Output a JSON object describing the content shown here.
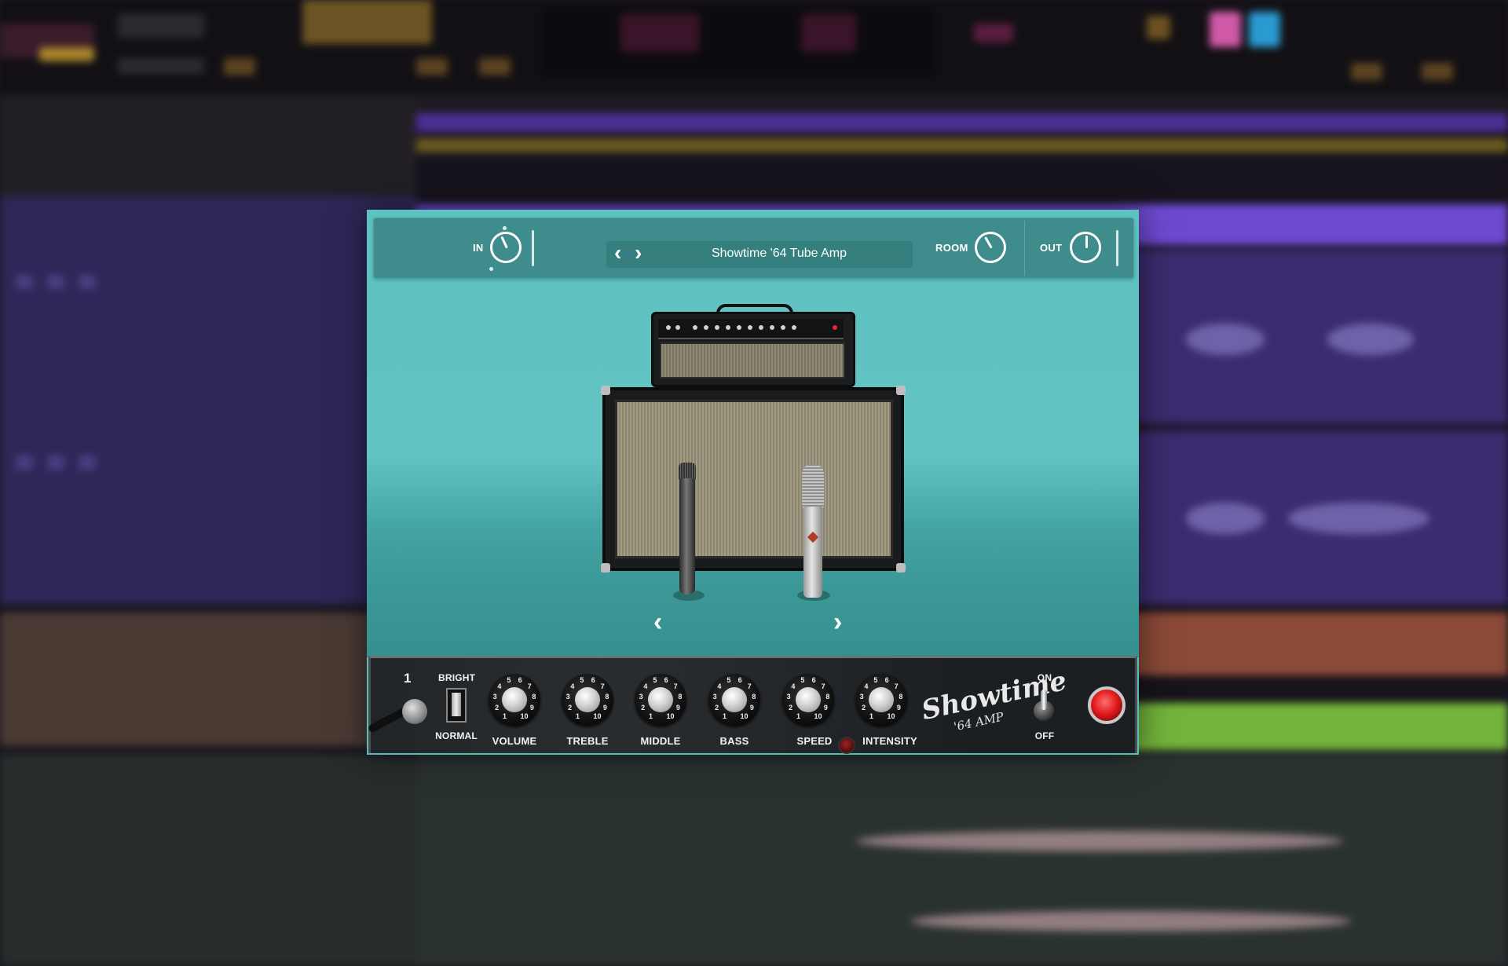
{
  "window": {
    "title": "Showtime '64 Tube Amp"
  },
  "header": {
    "in_label": "IN",
    "room_label": "ROOM",
    "out_label": "OUT",
    "preset_prev": "‹",
    "preset_next": "›",
    "preset_name": "Showtime '64 Tube Amp",
    "in_level": 0.4,
    "room_level": 0.3,
    "out_level": 0.5
  },
  "stage": {
    "prev_arrow": "‹",
    "next_arrow": "›"
  },
  "panel": {
    "channel_number": "1",
    "bright_label": "BRIGHT",
    "normal_label": "NORMAL",
    "knobs": [
      {
        "label": "VOLUME"
      },
      {
        "label": "TREBLE"
      },
      {
        "label": "MIDDLE"
      },
      {
        "label": "BASS"
      },
      {
        "label": "SPEED"
      },
      {
        "label": "INTENSITY"
      }
    ],
    "logo_text": "Showtime",
    "logo_subtext": "'64 AMP",
    "on_label": "ON",
    "off_label": "OFF"
  },
  "icons": {
    "jack": "input-jack-icon",
    "power": "power-lamp-icon"
  },
  "colors": {
    "stage_bg": "#5ec2c0",
    "header_bg": "#3e8c8c",
    "panel_bg": "#202427",
    "power_lamp": "#e31d1d",
    "daw_track_purple": "#3d2f78",
    "daw_track_orange": "#8f4d3a",
    "daw_track_green": "#6fb33a"
  }
}
